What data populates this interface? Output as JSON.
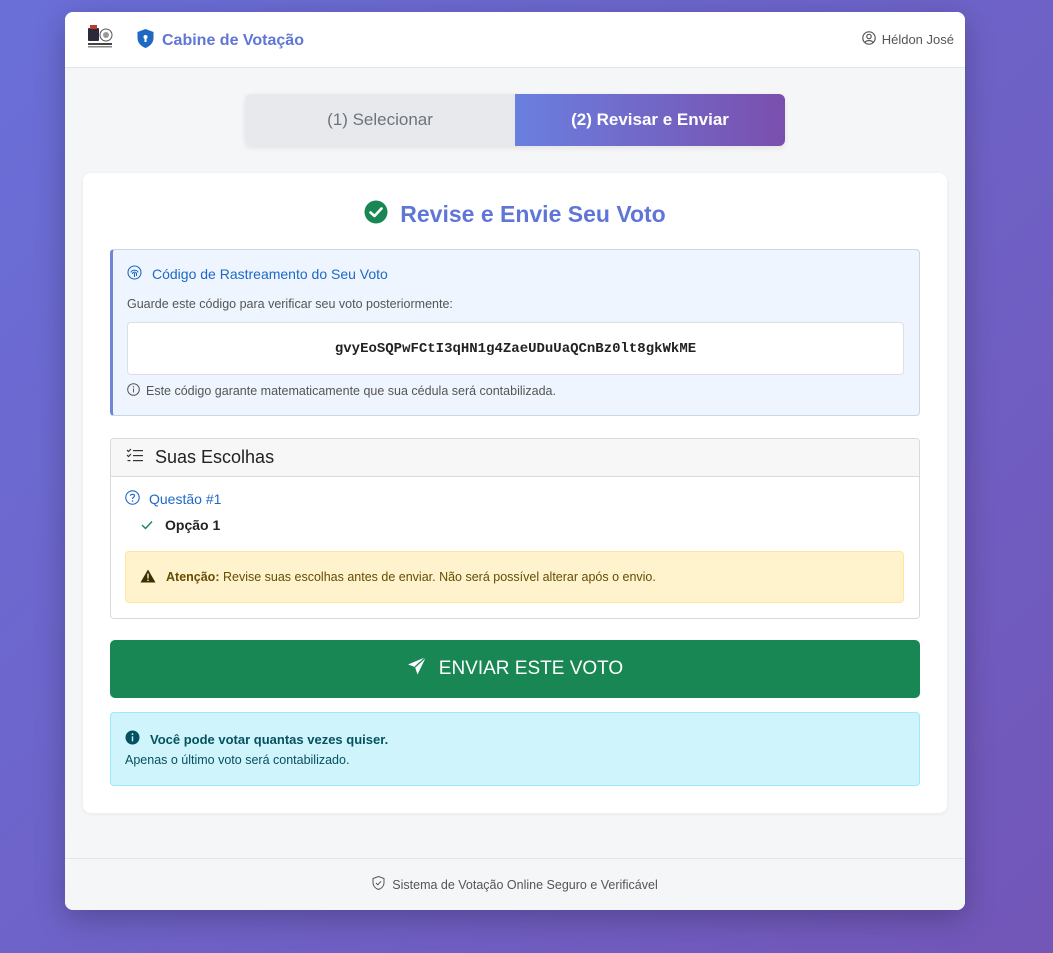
{
  "navbar": {
    "brand": "Cabine de Votação",
    "user_name": "Héldon José",
    "logo_icon": "university-seal-logo",
    "brand_icon": "shield-icon",
    "user_icon": "user-circle-icon"
  },
  "steps": [
    {
      "label": "(1) Selecionar",
      "active": false
    },
    {
      "label": "(2) Revisar e Enviar",
      "active": true
    }
  ],
  "review": {
    "title": "Revise e Envie Seu Voto",
    "title_icon": "check-circle-icon"
  },
  "tracking": {
    "heading": "Código de Rastreamento do Seu Voto",
    "subtitle": "Guarde este código para verificar seu voto posteriormente:",
    "code": "gvyEoSQPwFCtI3qHN1g4ZaeUDuUaQCnBz0lt8gkWkME",
    "note": "Este código garante matematicamente que sua cédula será contabilizada."
  },
  "choices": {
    "heading": "Suas Escolhas",
    "question": "Questão #1",
    "answer": "Opção 1",
    "warning_label": "Atenção:",
    "warning_text": "Revise suas escolhas antes de enviar. Não será possível alterar após o envio."
  },
  "submit": {
    "label": "ENVIAR ESTE VOTO"
  },
  "info": {
    "line1": "Você pode votar quantas vezes quiser.",
    "line2": "Apenas o último voto será contabilizado."
  },
  "footer": {
    "text": "Sistema de Votação Online Seguro e Verificável"
  },
  "colors": {
    "brand": "#6076d6",
    "success": "#198754",
    "link": "#1e69c4",
    "warning_bg": "#fff3cd",
    "info_bg": "#cff4fc"
  }
}
